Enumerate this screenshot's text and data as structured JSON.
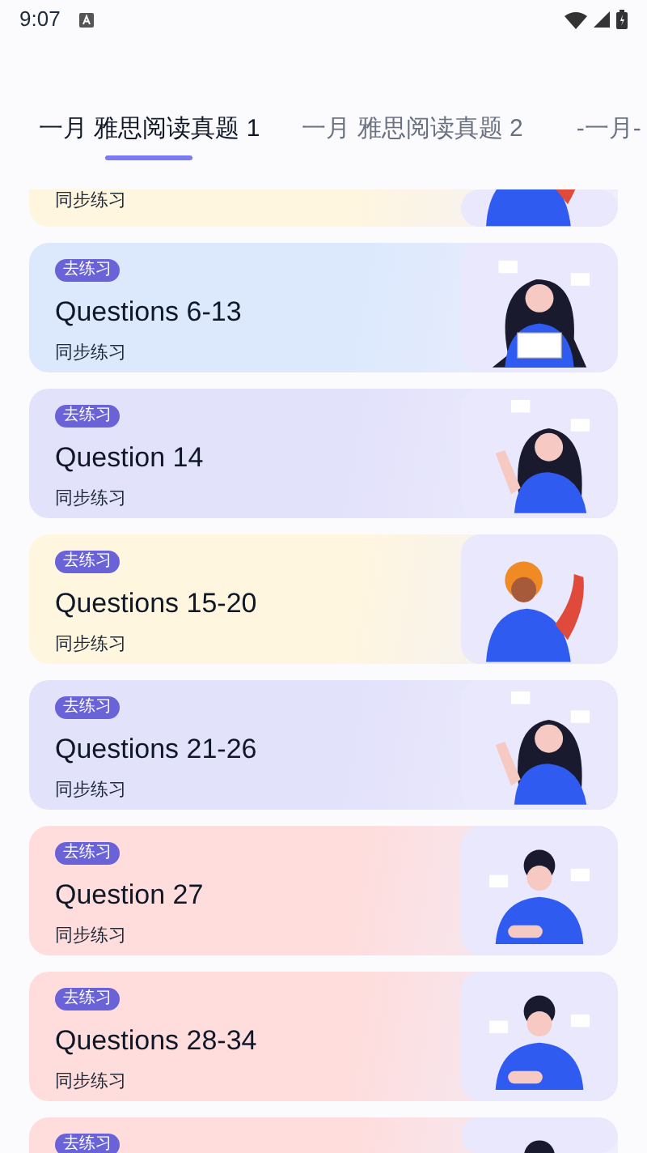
{
  "status_bar": {
    "time": "9:07"
  },
  "tabs": [
    {
      "label": "一月 雅思阅读真题 1",
      "selected": true
    },
    {
      "label": "一月 雅思阅读真题 2",
      "selected": false
    },
    {
      "label": "-一月-",
      "selected": false
    }
  ],
  "cards": [
    {
      "subtitle": "同步练习",
      "color": "#fff6e0",
      "kind": "man-waving"
    },
    {
      "badge": "去练习",
      "title": "Questions 6-13",
      "subtitle": "同步练习",
      "color": "#dce9fd",
      "kind": "woman-reading"
    },
    {
      "badge": "去练习",
      "title": "Question 14",
      "subtitle": "同步练习",
      "color": "#e3e2fb",
      "kind": "woman-pointing"
    },
    {
      "badge": "去练习",
      "title": "Questions 15-20",
      "subtitle": "同步练习",
      "color": "#fff6e0",
      "kind": "man-waving"
    },
    {
      "badge": "去练习",
      "title": "Questions 21-26",
      "subtitle": "同步练习",
      "color": "#e3e2fb",
      "kind": "woman-pointing"
    },
    {
      "badge": "去练习",
      "title": "Question 27",
      "subtitle": "同步练习",
      "color": "#ffdddd",
      "kind": "man-glasses"
    },
    {
      "badge": "去练习",
      "title": "Questions 28-34",
      "subtitle": "同步练习",
      "color": "#ffdddd",
      "kind": "man-glasses"
    },
    {
      "badge": "去练习",
      "color": "#ffdddd",
      "kind": "man-glasses"
    }
  ]
}
